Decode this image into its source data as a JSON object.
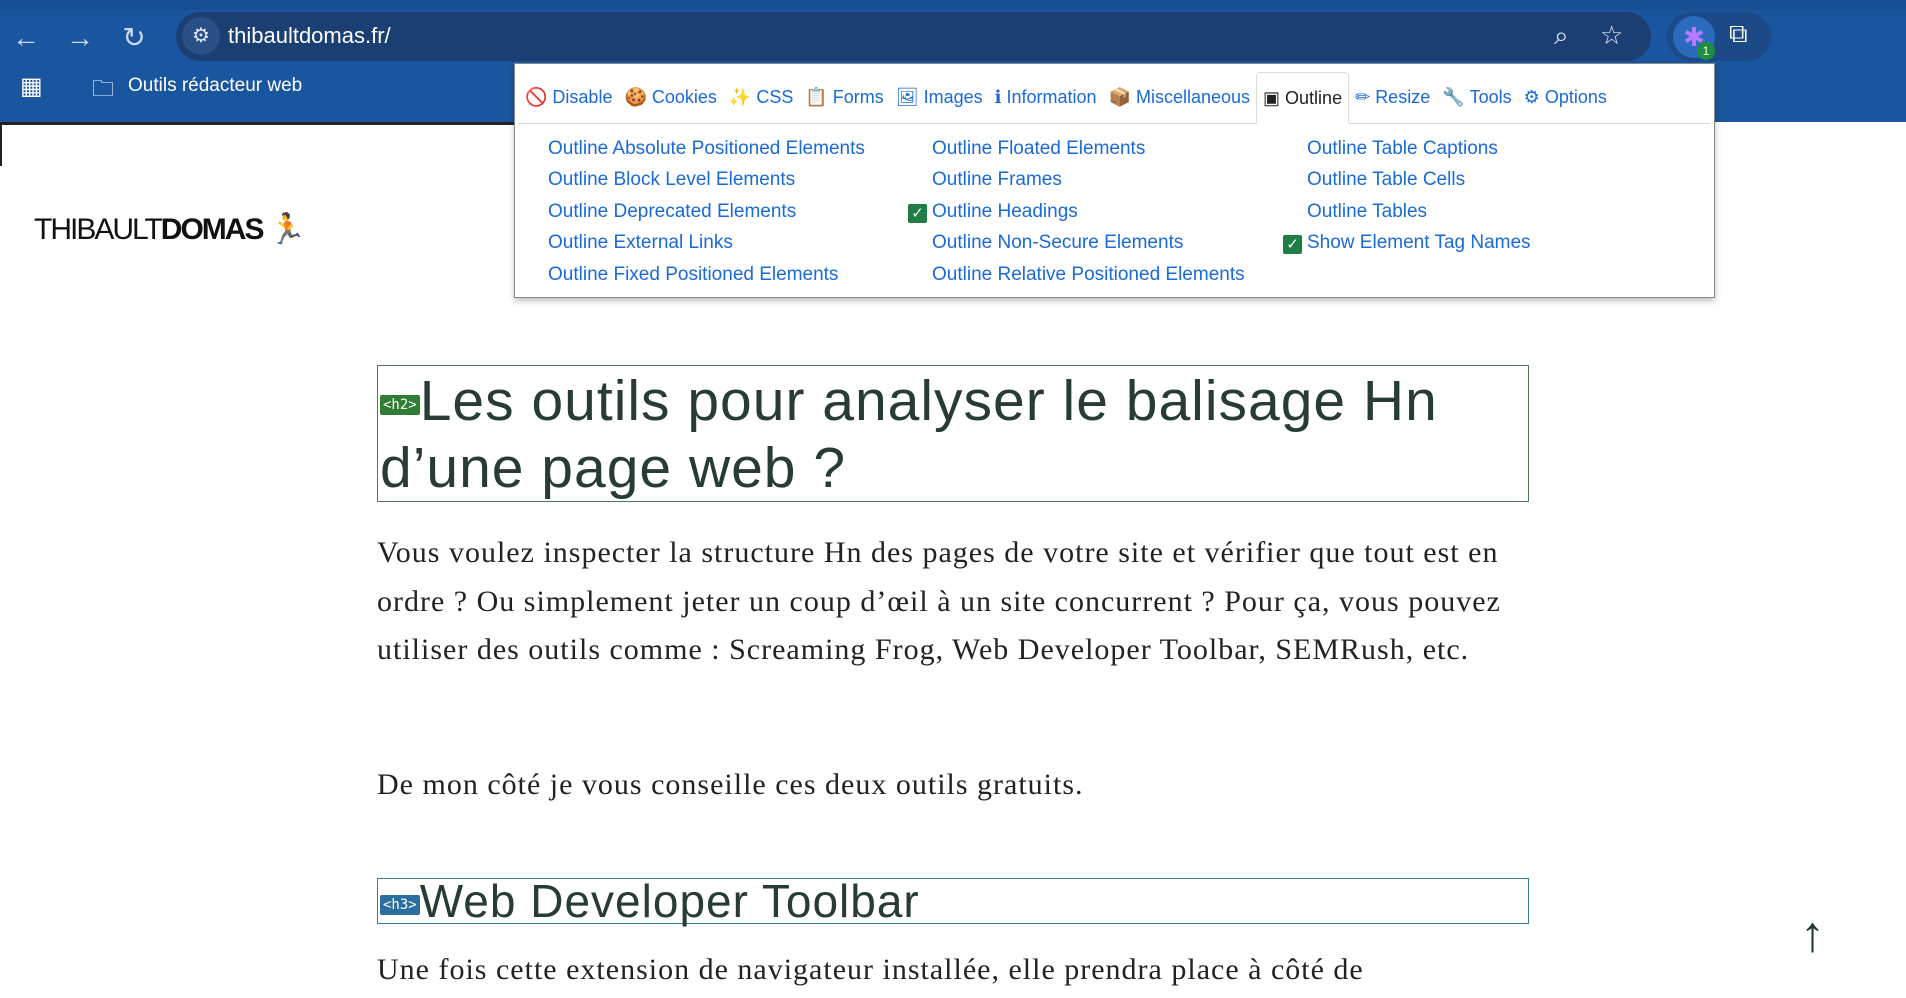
{
  "browser": {
    "url": "thibaultdomas.fr/",
    "bookmark_folder": "Outils rédacteur web",
    "extension_badge": "1"
  },
  "toolbar": {
    "tabs": [
      {
        "label": "Disable",
        "icon": "disable-icon",
        "glyph": "🚫"
      },
      {
        "label": "Cookies",
        "icon": "cookie-icon",
        "glyph": "🍪"
      },
      {
        "label": "CSS",
        "icon": "magic-wand-icon",
        "glyph": "✨"
      },
      {
        "label": "Forms",
        "icon": "clipboard-icon",
        "glyph": "📋"
      },
      {
        "label": "Images",
        "icon": "image-icon",
        "glyph": "🖼"
      },
      {
        "label": "Information",
        "icon": "info-icon",
        "glyph": "ℹ"
      },
      {
        "label": "Miscellaneous",
        "icon": "box-icon",
        "glyph": "📦"
      },
      {
        "label": "Outline",
        "icon": "outline-icon",
        "glyph": "▣",
        "active": true
      },
      {
        "label": "Resize",
        "icon": "pencil-icon",
        "glyph": "✏"
      },
      {
        "label": "Tools",
        "icon": "wrench-icon",
        "glyph": "🔧"
      },
      {
        "label": "Options",
        "icon": "sliders-icon",
        "glyph": "⚙"
      }
    ],
    "items": [
      [
        "Outline Absolute Positioned Elements",
        "Outline Block Level Elements",
        "Outline Deprecated Elements",
        "Outline External Links",
        "Outline Fixed Positioned Elements"
      ],
      [
        "Outline Floated Elements",
        "Outline Frames",
        "Outline Headings",
        "Outline Non-Secure Elements",
        "Outline Relative Positioned Elements"
      ],
      [
        "Outline Table Captions",
        "Outline Table Cells",
        "Outline Tables",
        "Show Element Tag Names"
      ]
    ],
    "checked": [
      "Outline Headings",
      "Show Element Tag Names"
    ]
  },
  "page": {
    "logo_light": "THIBAULT",
    "logo_bold": "DOMAS",
    "h2_tag": "<h2>",
    "h2": "Les outils pour analyser le balisage Hn d’une page web ?",
    "p1": "Vous voulez inspecter la structure Hn des pages de votre site et vérifier que tout est en ordre ? Ou simplement jeter un coup d’œil à un site concurrent ? Pour ça, vous pouvez utiliser des outils comme : Screaming Frog, Web Developer Toolbar, SEMRush, etc.",
    "p2": "De mon côté je vous conseille ces deux outils gratuits.",
    "h3_tag": "<h3>",
    "h3": "Web Developer Toolbar",
    "p3": "Une fois cette extension de navigateur installée, elle prendra place à côté de"
  },
  "colors": {
    "browser_blue": "#1a56a0",
    "link": "#1a6ad8",
    "check": "#1e7e45",
    "h2_tag": "#2e7d32",
    "h3_tag": "#2b6ea0"
  }
}
